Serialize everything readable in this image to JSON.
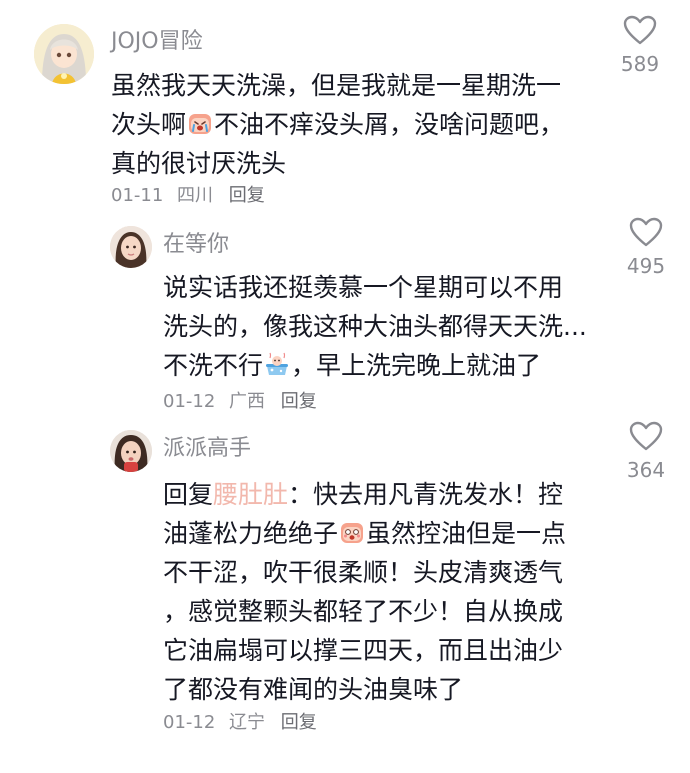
{
  "comments": [
    {
      "username": "JOJO冒险",
      "lines": [
        "虽然我天天洗澡，但是我就是一星期洗一",
        "次头啊",
        "不油不痒没头屑，没啥问题吧，",
        "真的很讨厌洗头"
      ],
      "date": "01-11",
      "location": "四川",
      "reply": "回复",
      "likes": "589",
      "avatar_icon": "anime-girl-avatar",
      "emoji_icon": "crying-face-emoji"
    },
    {
      "username": "在等你",
      "lines": [
        "说实话我还挺羡慕一个星期可以不用",
        "洗头的，像我这种大油头都得天天洗...",
        "不洗不行",
        "，早上洗完晚上就油了"
      ],
      "date": "01-12",
      "location": "广西",
      "reply": "回复",
      "likes": "495",
      "avatar_icon": "girl-photo-avatar",
      "emoji_icon": "hot-bath-emoji"
    },
    {
      "username": "派派高手",
      "reply_prefix": "回复",
      "mention": "腰肚肚",
      "lines": [
        "：快去用凡青洗发水！控",
        "油蓬松力绝绝子",
        "虽然控油但是一点",
        "不干涩，吹干很柔顺！头皮清爽透气",
        "，感觉整颗头都轻了不少！自从换成",
        "它油扁塌可以撑三四天，而且出油少",
        "了都没有难闻的头油臭味了"
      ],
      "date": "01-12",
      "location": "辽宁",
      "reply": "回复",
      "likes": "364",
      "avatar_icon": "girl-photo-avatar",
      "emoji_icon": "excited-face-emoji"
    }
  ]
}
